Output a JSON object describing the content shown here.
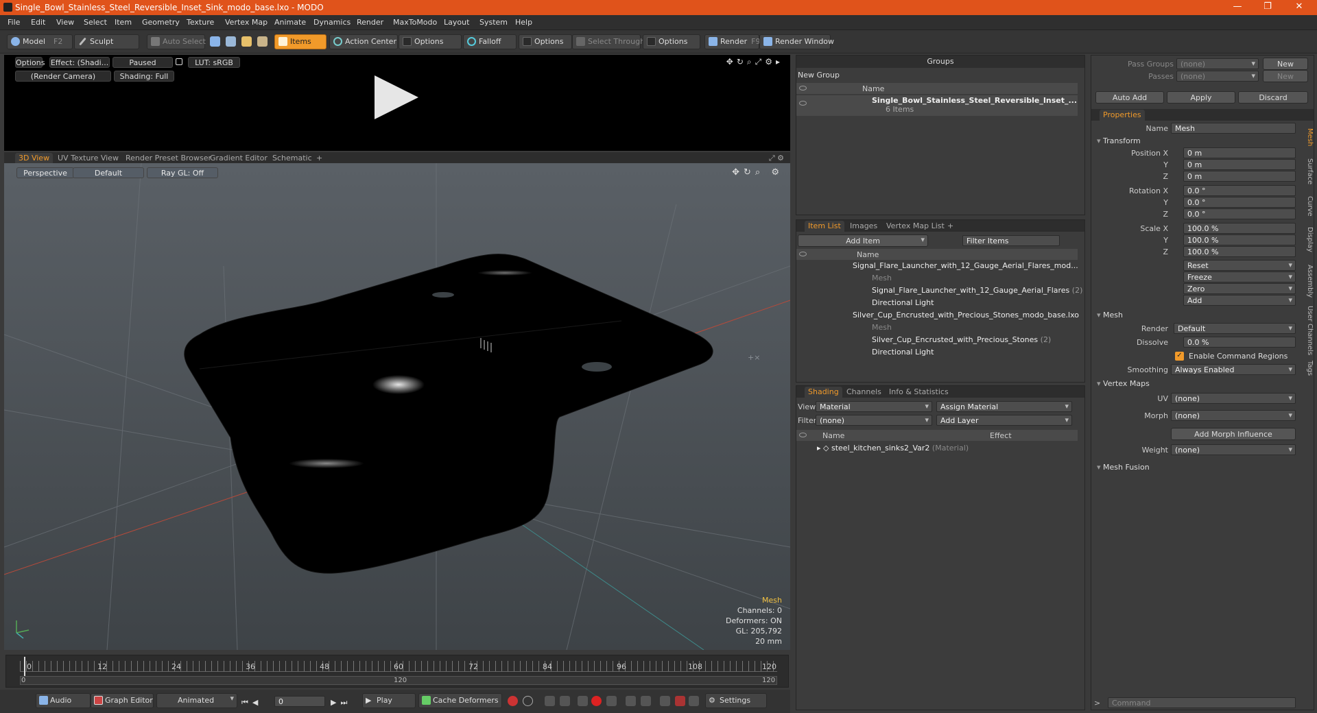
{
  "window": {
    "title": "Single_Bowl_Stainless_Steel_Reversible_Inset_Sink_modo_base.lxo - MODO"
  },
  "menu": [
    "File",
    "Edit",
    "View",
    "Select",
    "Item",
    "Geometry",
    "Texture",
    "Vertex Map",
    "Animate",
    "Dynamics",
    "Render",
    "MaxToModo",
    "Layout",
    "System",
    "Help"
  ],
  "toolbar": {
    "model": "Model",
    "model_key": "F2",
    "sculpt": "Sculpt",
    "auto_select": "Auto Select",
    "items": "Items",
    "action_center": "Action Center",
    "options1": "Options",
    "falloff": "Falloff",
    "options2": "Options",
    "select_through": "Select Through",
    "options3": "Options",
    "render": "Render",
    "render_key": "F9",
    "render_window": "Render Window"
  },
  "render_view": {
    "options": "Options",
    "effect": "Effect: (Shadi...",
    "paused": "Paused",
    "lut": "LUT: sRGB",
    "camera": "(Render Camera)",
    "shading": "Shading: Full"
  },
  "viewport_tabs": [
    "3D View",
    "UV Texture View",
    "Render Preset Browser",
    "Gradient Editor",
    "Schematic"
  ],
  "viewport": {
    "perspective": "Perspective",
    "default": "Default",
    "raygl": "Ray GL: Off",
    "stats": {
      "title": "Mesh",
      "channels": "Channels: 0",
      "deformers": "Deformers: ON",
      "gl": "GL: 205,792",
      "size": "20 mm"
    }
  },
  "timeline": {
    "ticks": [
      "0",
      "12",
      "24",
      "36",
      "48",
      "60",
      "72",
      "84",
      "96",
      "108",
      "120"
    ],
    "lower": [
      "0",
      "120",
      "120"
    ]
  },
  "transport": {
    "audio": "Audio",
    "graph_editor": "Graph Editor",
    "animated": "Animated",
    "frame": "0",
    "play": "Play",
    "cache": "Cache Deformers",
    "settings": "Settings"
  },
  "groups": {
    "title": "Groups",
    "new_group": "New Group",
    "col_name": "Name",
    "item_name": "Single_Bowl_Stainless_Steel_Reversible_Inset_...",
    "item_count": "6 Items"
  },
  "item_list": {
    "tabs": [
      "Item List",
      "Images",
      "Vertex Map List"
    ],
    "add_item": "Add Item",
    "filter": "Filter Items",
    "col_name": "Name",
    "rows": [
      {
        "name": "Signal_Flare_Launcher_with_12_Gauge_Aerial_Flares_mod...",
        "extra": ""
      },
      {
        "name": "Mesh",
        "extra": ""
      },
      {
        "name": "Signal_Flare_Launcher_with_12_Gauge_Aerial_Flares",
        "extra": "(2)"
      },
      {
        "name": "Directional Light",
        "extra": ""
      },
      {
        "name": "Silver_Cup_Encrusted_with_Precious_Stones_modo_base.lxo",
        "extra": ""
      },
      {
        "name": "Mesh",
        "extra": ""
      },
      {
        "name": "Silver_Cup_Encrusted_with_Precious_Stones",
        "extra": "(2)"
      },
      {
        "name": "Directional Light",
        "extra": ""
      }
    ]
  },
  "shading": {
    "tabs": [
      "Shading",
      "Channels",
      "Info & Statistics"
    ],
    "view_label": "View",
    "view_value": "Material",
    "assign": "Assign Material",
    "filter_label": "Filter",
    "filter_value": "(none)",
    "add_layer": "Add Layer",
    "col_name": "Name",
    "col_effect": "Effect",
    "material": "steel_kitchen_sinks2_Var2",
    "material_type": "(Material)"
  },
  "properties": {
    "pass_groups": "Pass Groups",
    "pass_groups_val": "(none)",
    "passes": "Passes",
    "passes_val": "(none)",
    "new": "New",
    "new2": "New",
    "auto_add": "Auto Add",
    "apply": "Apply",
    "discard": "Discard",
    "tab": "Properties",
    "name_label": "Name",
    "name_value": "Mesh",
    "transform": "Transform",
    "position_label": "Position X",
    "rotation_label": "Rotation X",
    "scale_label": "Scale X",
    "y": "Y",
    "z": "Z",
    "pos": [
      "0 m",
      "0 m",
      "0 m"
    ],
    "rot": [
      "0.0 °",
      "0.0 °",
      "0.0 °"
    ],
    "scl": [
      "100.0 %",
      "100.0 %",
      "100.0 %"
    ],
    "reset": "Reset",
    "freeze": "Freeze",
    "zero": "Zero",
    "add": "Add",
    "mesh": "Mesh",
    "render_label": "Render",
    "render_value": "Default",
    "dissolve_label": "Dissolve",
    "dissolve_value": "0.0 %",
    "enable_cmd": "Enable Command Regions",
    "smoothing_label": "Smoothing",
    "smoothing_value": "Always Enabled",
    "vertex_maps": "Vertex Maps",
    "uv_label": "UV",
    "uv_value": "(none)",
    "morph_label": "Morph",
    "morph_value": "(none)",
    "add_morph": "Add Morph Influence",
    "weight_label": "Weight",
    "weight_value": "(none)",
    "mesh_fusion": "Mesh Fusion",
    "side_tabs": [
      "Mesh",
      "Surface",
      "Curve",
      "Display",
      "Assembly",
      "User Channels",
      "Tags"
    ],
    "command": "Command"
  }
}
